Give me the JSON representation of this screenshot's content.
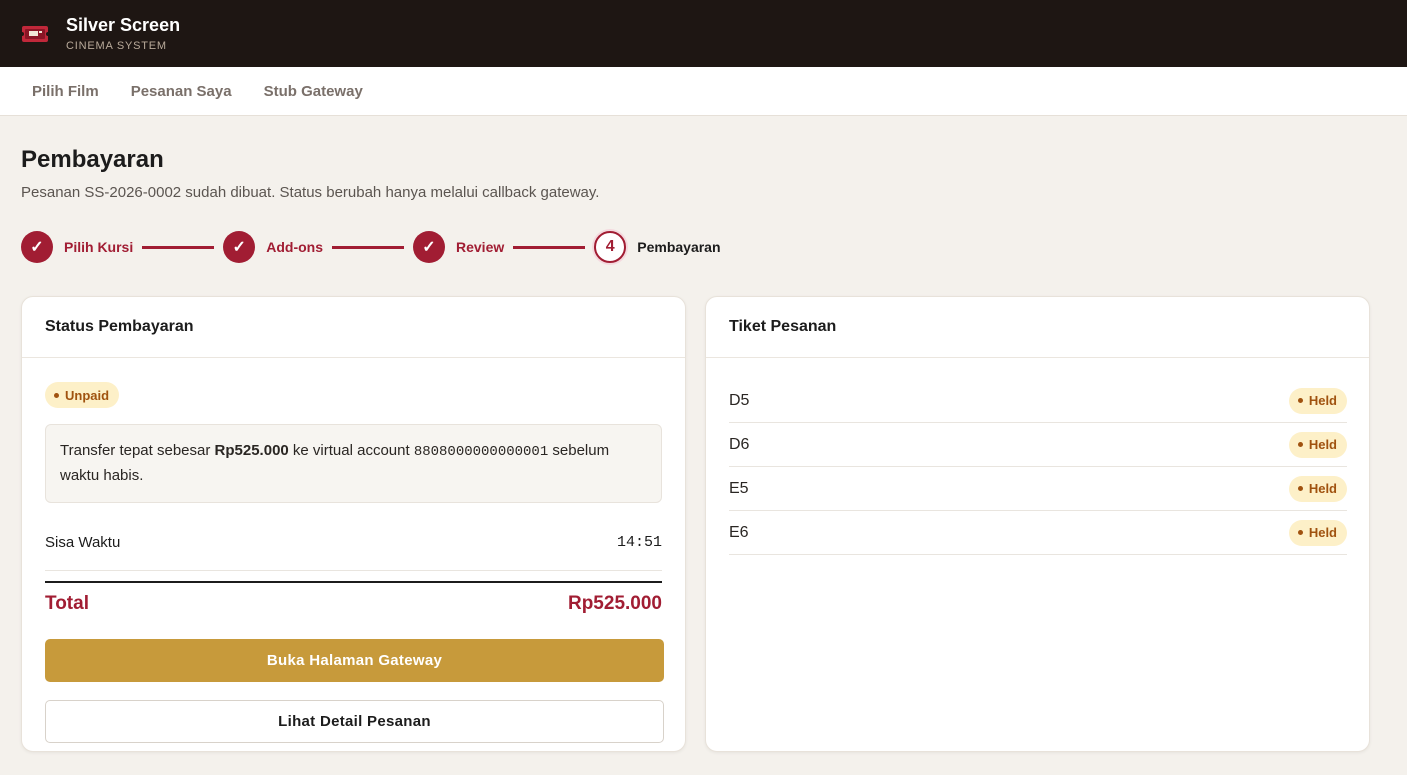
{
  "app": {
    "title": "Silver Screen",
    "subtitle": "CINEMA SYSTEM",
    "logo_icon": "ticket-icon",
    "colors": {
      "header_bg": "#1e1613",
      "accent": "#a11d33",
      "gold": "#c79a3b",
      "badge_bg": "#fdf0c8",
      "badge_text": "#a0520f"
    }
  },
  "nav": {
    "items": [
      {
        "label": "Pilih Film"
      },
      {
        "label": "Pesanan Saya"
      },
      {
        "label": "Stub Gateway"
      }
    ]
  },
  "page": {
    "title": "Pembayaran",
    "subtitle": "Pesanan SS-2026-0002 sudah dibuat. Status berubah hanya melalui callback gateway."
  },
  "stepper": {
    "steps": [
      {
        "label": "Pilih Kursi",
        "marker": "✓",
        "state": "done"
      },
      {
        "label": "Add-ons",
        "marker": "✓",
        "state": "done"
      },
      {
        "label": "Review",
        "marker": "✓",
        "state": "done"
      },
      {
        "label": "Pembayaran",
        "marker": "4",
        "state": "current"
      }
    ]
  },
  "payment": {
    "title": "Status Pembayaran",
    "status_badge": "Unpaid",
    "notice": {
      "prefix": "Transfer tepat sebesar ",
      "amount": "Rp525.000",
      "middle": " ke virtual account ",
      "account": "8808000000000001",
      "suffix": " sebelum waktu habis."
    },
    "time_left_label": "Sisa Waktu",
    "time_left_value": "14:51",
    "total_label": "Total",
    "total_value": "Rp525.000",
    "primary_button": "Buka Halaman Gateway",
    "secondary_button": "Lihat Detail Pesanan"
  },
  "tickets": {
    "title": "Tiket Pesanan",
    "items": [
      {
        "seat": "D5",
        "status": "Held"
      },
      {
        "seat": "D6",
        "status": "Held"
      },
      {
        "seat": "E5",
        "status": "Held"
      },
      {
        "seat": "E6",
        "status": "Held"
      }
    ]
  }
}
